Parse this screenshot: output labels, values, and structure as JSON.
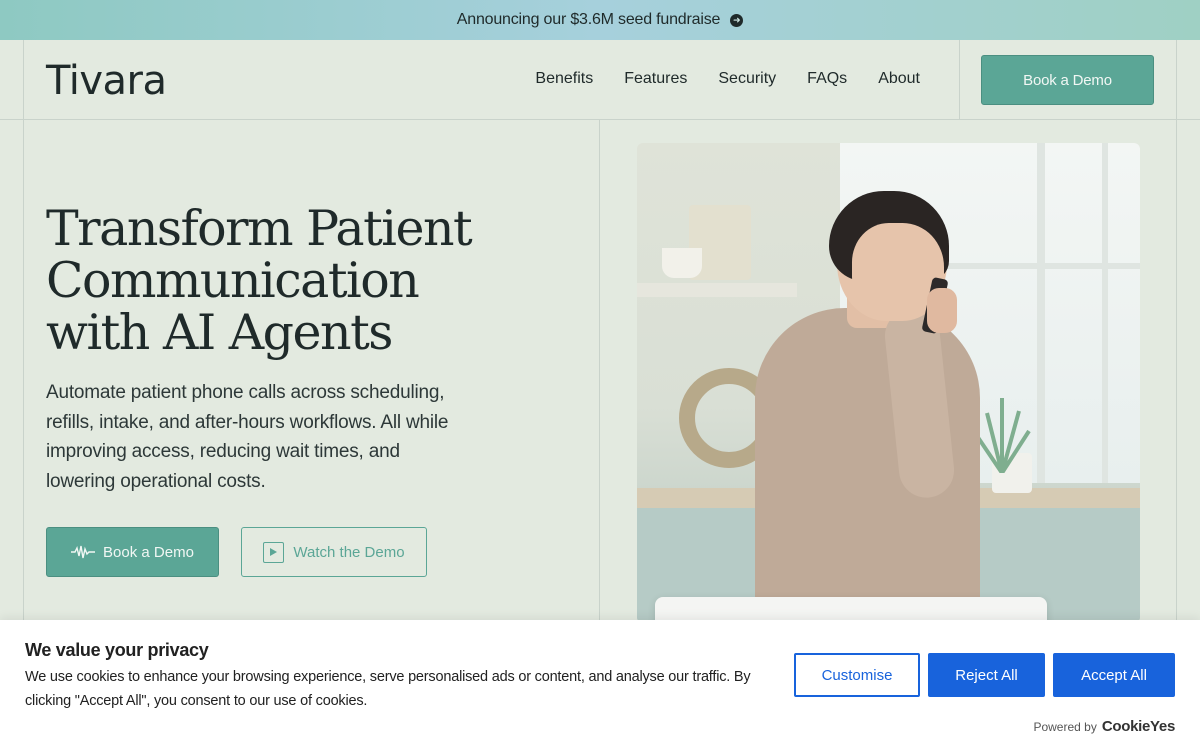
{
  "announcement": {
    "text": "Announcing our $3.6M seed fundraise",
    "icon": "arrow-right-circle-icon"
  },
  "nav": {
    "logo": "Tivara",
    "links": [
      "Benefits",
      "Features",
      "Security",
      "FAQs",
      "About"
    ],
    "cta": "Book a Demo"
  },
  "hero": {
    "title_lines": [
      "Transform Patient",
      "Communication",
      "with AI Agents"
    ],
    "subtitle": "Automate patient phone calls across scheduling, refills, intake, and after-hours workflows. All while improving access, reducing wait times, and lowering operational costs.",
    "primary_cta": "Book a Demo",
    "primary_icon": "waveform-icon",
    "secondary_cta": "Watch the Demo",
    "secondary_icon": "play-icon"
  },
  "cookie_banner": {
    "title": "We value your privacy",
    "text": "We use cookies to enhance your browsing experience, serve personalised ads or content, and analyse our traffic. By clicking \"Accept All\", you consent to our use of cookies.",
    "customise": "Customise",
    "reject": "Reject All",
    "accept": "Accept All",
    "powered_by": "Powered by",
    "brand": "CookieYes"
  },
  "colors": {
    "accent": "#5ba696",
    "page_bg": "#e3eae0",
    "cookie_button": "#1863dc"
  }
}
